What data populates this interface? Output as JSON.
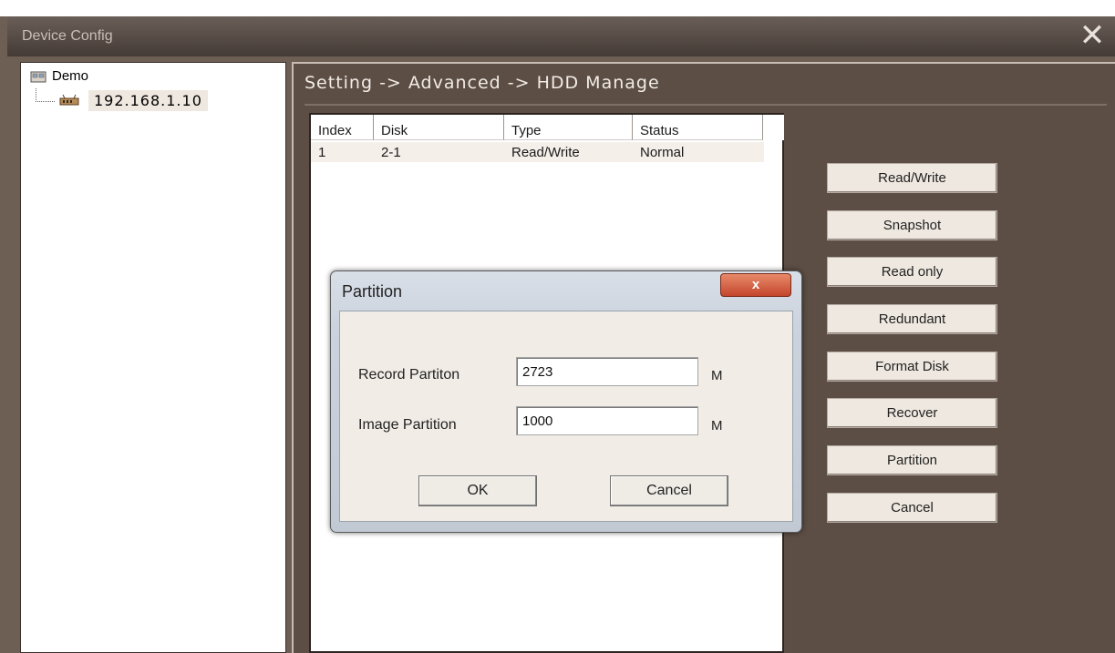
{
  "window": {
    "title": "Device Config",
    "close_label": "✕"
  },
  "tree": {
    "root": "Demo",
    "device": "192.168.1.10"
  },
  "breadcrumb": "Setting -> Advanced -> HDD Manage",
  "disk_table": {
    "headers": [
      "Index",
      "Disk",
      "Type",
      "Status"
    ],
    "rows": [
      [
        "1",
        "2-1",
        "Read/Write",
        "Normal"
      ]
    ]
  },
  "actions": [
    "Read/Write",
    "Snapshot",
    "Read only",
    "Redundant",
    "Format Disk",
    "Recover",
    "Partition",
    "Cancel"
  ],
  "partition_dialog": {
    "title": "Partition",
    "close_label": "x",
    "record_label": "Record Partiton",
    "record_value": "2723",
    "record_unit": "M",
    "image_label": "Image Partition",
    "image_value": "1000",
    "image_unit": "M",
    "ok_label": "OK",
    "cancel_label": "Cancel"
  }
}
